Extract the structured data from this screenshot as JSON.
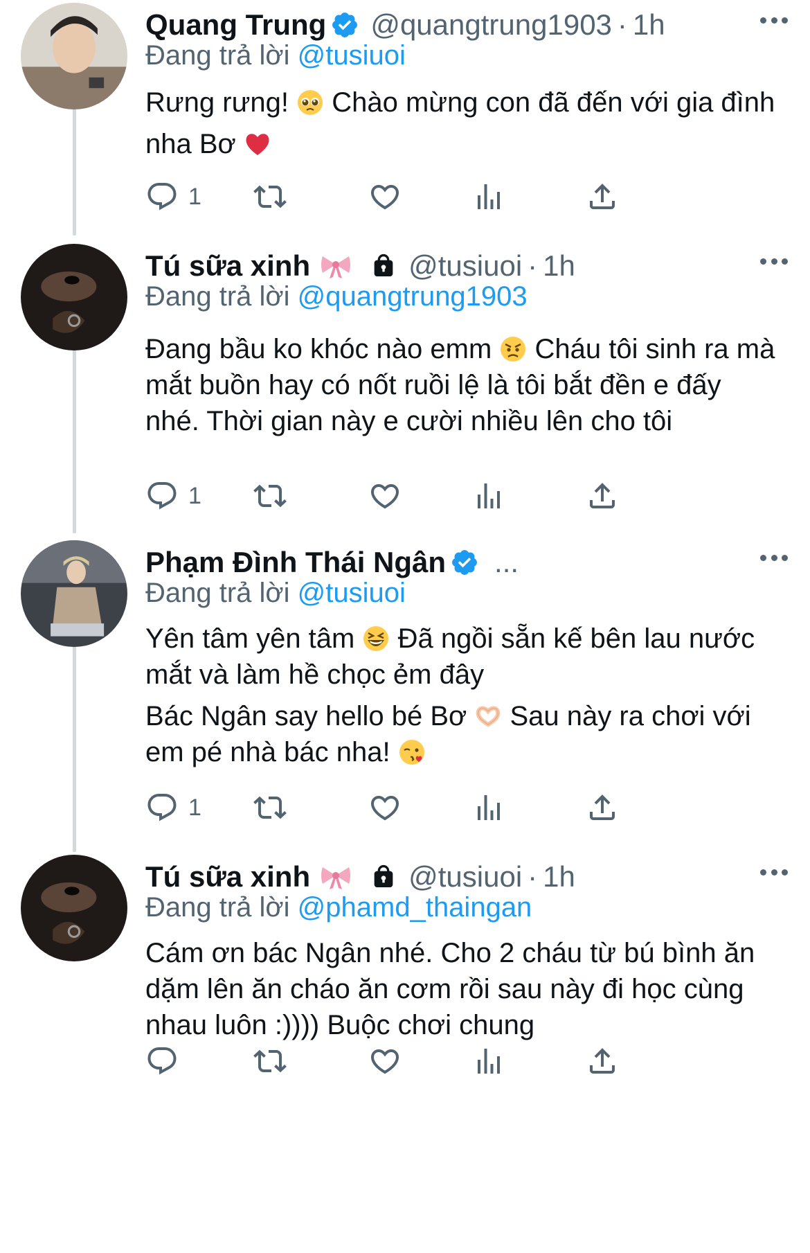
{
  "tweets": [
    {
      "name": "Quang Trung",
      "verified": true,
      "handle": "@quangtrung1903",
      "time": "1h",
      "replying_label": "Đang trả lời",
      "replying_to": "@tusiuoi",
      "paragraphs": [
        [
          "Rưng rưng! ",
          "[emoji:pleading-face]",
          " Chào mừng con đã đến với gia đình nha Bơ ",
          "[emoji:red-heart]"
        ]
      ],
      "reply_count": "1"
    },
    {
      "name": "Tú sữa xinh",
      "verified": false,
      "handle": "@tusiuoi",
      "time": "1h",
      "replying_label": "Đang trả lời",
      "replying_to": "@quangtrung1903",
      "paragraphs": [
        [
          "Đang bầu ko khóc nào emm ",
          "[emoji:angry-face]",
          " Cháu tôi sinh ra mà mắt buồn hay có nốt ruồi lệ là tôi bắt đền e đấy nhé. Thời gian này e cười nhiều lên cho tôi"
        ]
      ],
      "reply_count": "1"
    },
    {
      "name": "Phạm Đình Thái Ngân",
      "verified": true,
      "handle": "...",
      "time": "",
      "replying_label": "Đang trả lời",
      "replying_to": "@tusiuoi",
      "paragraphs": [
        [
          "Yên tâm yên tâm ",
          "[emoji:grinning-squinting-face]",
          " Đã ngồi sẵn kế bên lau nước mắt và làm hề chọc ẻm đây"
        ],
        [
          "Bác Ngân say hello bé Bơ ",
          "[emoji:heart-hands]",
          " Sau này ra chơi với em pé nhà bác nha! ",
          "[emoji:face-blowing-kiss]"
        ]
      ],
      "reply_count": "1"
    },
    {
      "name": "Tú sữa xinh",
      "verified": false,
      "handle": "@tusiuoi",
      "time": "1h",
      "replying_label": "Đang trả lời",
      "replying_to": "@phamd_thaingan",
      "paragraphs": [
        [
          "Cám ơn bác Ngân nhé. Cho 2 cháu từ bú bình ăn dặm lên ăn cháo ăn cơm rồi sau này đi học cùng nhau luôn :)))) Buộc chơi chung"
        ]
      ],
      "reply_count": ""
    }
  ],
  "icons": {
    "verified": "verified-badge-icon",
    "bow": "ribbon-icon",
    "lock": "lock-icon",
    "reply": "reply-icon",
    "retweet": "retweet-icon",
    "like": "heart-icon",
    "views": "bar-chart-icon",
    "share": "share-icon",
    "more": "more-options-icon"
  },
  "colors": {
    "text": "#0f1419",
    "secondary": "#536471",
    "link": "#1d9bf0",
    "thread_line": "#cfd9de"
  }
}
